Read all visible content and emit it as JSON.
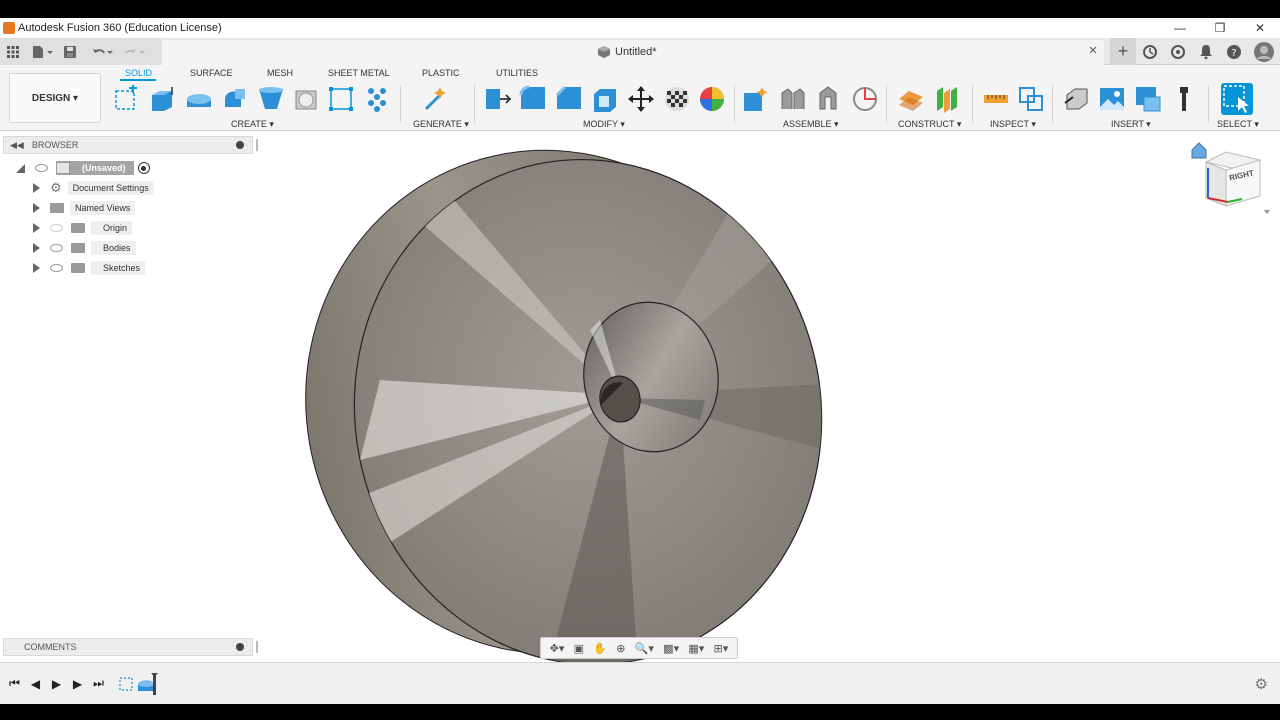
{
  "window": {
    "title": "Autodesk Fusion 360 (Education License)",
    "minimize": "—",
    "restore": "❐",
    "close": "✕"
  },
  "document": {
    "title": "Untitled*",
    "close": "✕",
    "new_tab": "+"
  },
  "workspace": {
    "label": "DESIGN ▾"
  },
  "tabs": [
    "SOLID",
    "SURFACE",
    "MESH",
    "SHEET METAL",
    "PLASTIC",
    "UTILITIES"
  ],
  "active_tab": "SOLID",
  "groups": {
    "create": "CREATE ▾",
    "generate": "GENERATE ▾",
    "modify": "MODIFY ▾",
    "assemble": "ASSEMBLE ▾",
    "construct": "CONSTRUCT ▾",
    "inspect": "INSPECT ▾",
    "insert": "INSERT ▾",
    "select": "SELECT ▾"
  },
  "browser": {
    "title": "BROWSER",
    "root": "(Unsaved)",
    "items": [
      "Document Settings",
      "Named Views",
      "Origin",
      "Bodies",
      "Sketches"
    ]
  },
  "comments": {
    "title": "COMMENTS"
  },
  "viewcube": {
    "face_label": "RIGHT"
  },
  "colors": {
    "accent": "#0696d7",
    "body_metal": "#8a8680",
    "toolbar_bg": "#f4f4f4"
  }
}
